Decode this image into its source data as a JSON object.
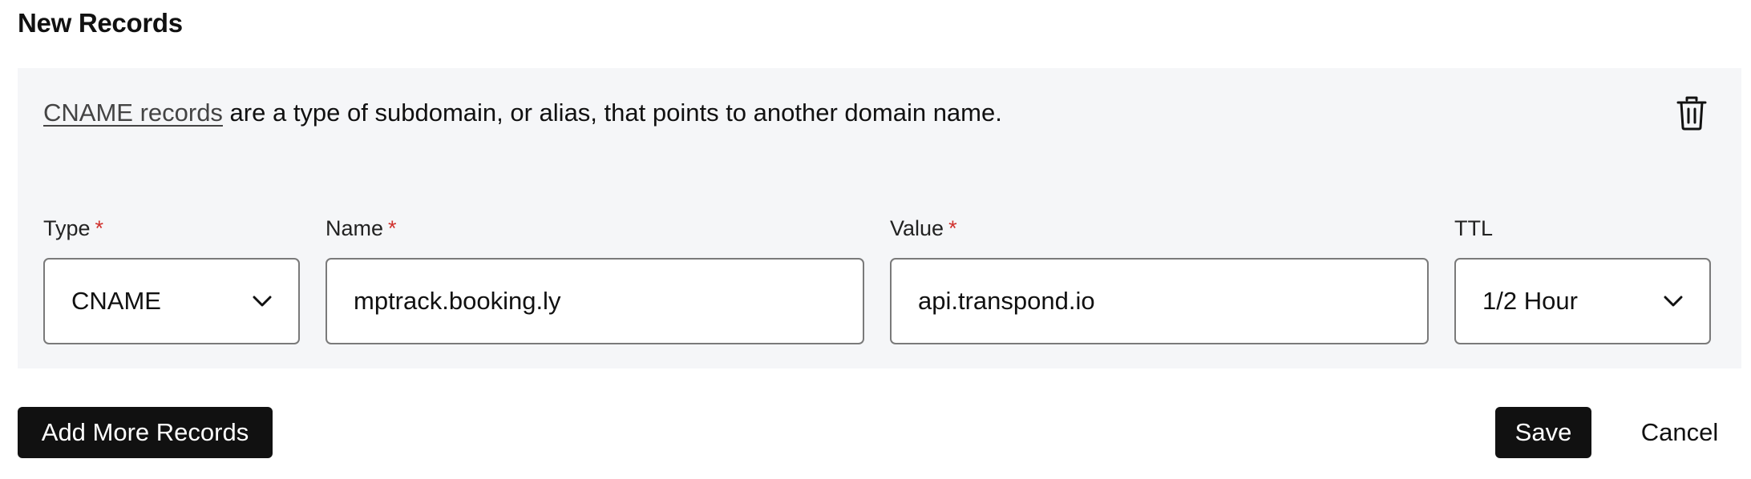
{
  "section": {
    "title": "New Records"
  },
  "record": {
    "info": {
      "link_text": "CNAME records",
      "text": " are a type of subdomain, or alias, that points to another domain name."
    },
    "delete_icon": "trash-icon",
    "fields": {
      "type": {
        "label": "Type",
        "required_mark": "*",
        "value": "CNAME"
      },
      "name": {
        "label": "Name",
        "required_mark": "*",
        "value": "mptrack.booking.ly"
      },
      "value": {
        "label": "Value",
        "required_mark": "*",
        "value": "api.transpond.io"
      },
      "ttl": {
        "label": "TTL",
        "value": "1/2 Hour"
      }
    }
  },
  "actions": {
    "add_more_label": "Add More Records",
    "save_label": "Save",
    "cancel_label": "Cancel"
  },
  "colors": {
    "panel_background": "#f5f6f8",
    "primary_button": "#111111",
    "required": "#d0312d",
    "input_border": "#7a7a7a"
  }
}
